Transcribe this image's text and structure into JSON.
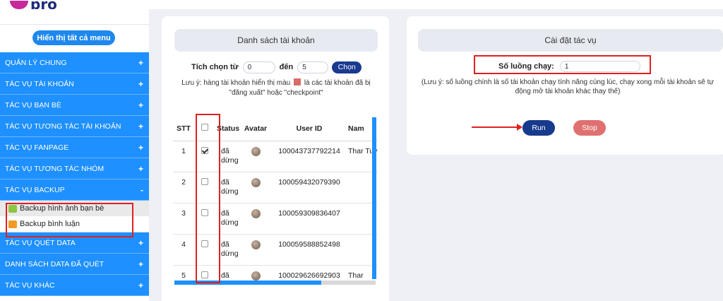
{
  "logo_text": "pro",
  "sidebar": {
    "show_all_menu": "Hiển thị tất cả menu",
    "items": [
      {
        "label": "QUẢN LÝ CHUNG",
        "sign": "+"
      },
      {
        "label": "TÁC VỤ TÀI KHOẢN",
        "sign": "+"
      },
      {
        "label": "TÁC VỤ BẠN BÈ",
        "sign": "+"
      },
      {
        "label": "TÁC VỤ TƯƠNG TÁC TÀI KHOẢN",
        "sign": "+"
      },
      {
        "label": "TÁC VỤ FANPAGE",
        "sign": "+"
      },
      {
        "label": "TÁC VỤ TƯƠNG TÁC NHÓM",
        "sign": "+"
      },
      {
        "label": "TÁC VỤ BACKUP",
        "sign": "-"
      },
      {
        "label": "TÁC VỤ QUÉT DATA",
        "sign": "+"
      },
      {
        "label": "DANH SÁCH DATA ĐÃ QUÉT",
        "sign": "+"
      },
      {
        "label": "TÁC VỤ KHÁC",
        "sign": "+"
      }
    ],
    "backup_submenu": [
      {
        "label": "Backup hình ảnh bạn bè",
        "icon": "image-icon",
        "color": "#8dc63f"
      },
      {
        "label": "Backup bình luận",
        "icon": "comment-icon",
        "color": "#f29b24"
      }
    ]
  },
  "accounts": {
    "title": "Danh sách tài khoản",
    "select_from_label": "Tích chọn từ",
    "from_value": "0",
    "to_label": "đến",
    "to_value": "5",
    "choose_label": "Chọn",
    "note_before": "Lưu ý: hàng tài khoản hiển thị màu",
    "note_after": "là các tài khoản đã bị \"đăng xuất\" hoặc \"checkpoint\"",
    "note_color": "#d96a6a",
    "columns": {
      "stt": "STT",
      "status": "Status",
      "avatar": "Avatar",
      "user_id": "User ID",
      "name": "Nam"
    },
    "rows": [
      {
        "stt": "1",
        "checked": true,
        "status": "đã dừng",
        "user_id": "100043737792214",
        "name": "Thar Tuyê"
      },
      {
        "stt": "2",
        "checked": false,
        "status": "đã dừng",
        "user_id": "100059432079390",
        "name": ""
      },
      {
        "stt": "3",
        "checked": false,
        "status": "đã dừng",
        "user_id": "100059309836407",
        "name": ""
      },
      {
        "stt": "4",
        "checked": false,
        "status": "đã dừng",
        "user_id": "100059588852498",
        "name": ""
      },
      {
        "stt": "5",
        "checked": false,
        "status": "đã",
        "user_id": "100029626692903",
        "name": "Thar"
      }
    ]
  },
  "settings": {
    "title": "Cài đặt tác vụ",
    "threads_label": "Số luồng chạy:",
    "threads_value": "1",
    "note": "(Lưu ý: số luồng chính là số tài khoản chạy tính năng cùng lúc, chạy xong mỗi tài khoản sẽ tự động mở tài khoản khác thay thế)",
    "run_label": "Run",
    "stop_label": "Stop"
  },
  "colors": {
    "primary": "#1e90ff",
    "dark_button": "#1a3a8f",
    "stop_button": "#e07070",
    "annotation": "#e02020"
  }
}
